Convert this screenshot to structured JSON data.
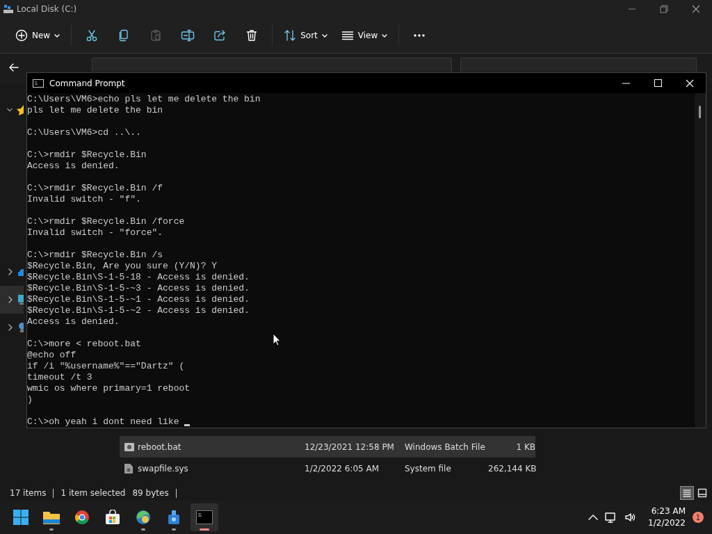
{
  "explorer": {
    "title": "Local Disk (C:)",
    "toolbar": [
      {
        "kind": "new",
        "label": "New",
        "disabled": false
      },
      {
        "kind": "cut",
        "disabled": false
      },
      {
        "kind": "copy",
        "disabled": false
      },
      {
        "kind": "paste",
        "disabled": true
      },
      {
        "kind": "rename",
        "disabled": false
      },
      {
        "kind": "share",
        "disabled": false
      },
      {
        "kind": "delete",
        "disabled": false
      },
      {
        "kind": "sort",
        "label": "Sort",
        "disabled": false
      },
      {
        "kind": "view",
        "label": "View",
        "disabled": false
      },
      {
        "kind": "more",
        "disabled": false
      }
    ],
    "sidebar": {
      "items": [
        {
          "kind": "quick-access",
          "expanded": true,
          "selected": false
        },
        {
          "kind": "cloud",
          "expanded": false,
          "selected": false
        },
        {
          "kind": "computer",
          "expanded": false,
          "selected": true
        },
        {
          "kind": "network",
          "expanded": false,
          "selected": false
        }
      ]
    },
    "files": [
      {
        "name": "reboot.bat",
        "kind": "batch",
        "modified": "12/23/2021 12:58 PM",
        "type": "Windows Batch File",
        "size": "1 KB",
        "selected": true
      },
      {
        "name": "swapfile.sys",
        "kind": "system",
        "modified": "1/2/2022 6:05 AM",
        "type": "System file",
        "size": "262,144 KB",
        "selected": false
      }
    ],
    "status_bar": {
      "items": "17 items",
      "selection": "1 item selected",
      "size": "89 bytes",
      "views": [
        {
          "kind": "details",
          "selected": true
        },
        {
          "kind": "tiles",
          "selected": false
        }
      ]
    }
  },
  "console": {
    "title": "Command Prompt",
    "blocks": [
      [
        "C:\\Users\\VM6>echo pls let me delete the bin",
        "pls let me delete the bin"
      ],
      [
        "C:\\Users\\VM6>cd ..\\.."
      ],
      [
        "C:\\>rmdir $Recycle.Bin",
        "Access is denied."
      ],
      [
        "C:\\>rmdir $Recycle.Bin /f",
        "Invalid switch - \"f\"."
      ],
      [
        "C:\\>rmdir $Recycle.Bin /force",
        "Invalid switch - \"force\"."
      ],
      [
        "C:\\>rmdir $Recycle.Bin /s",
        "$Recycle.Bin, Are you sure (Y/N)? Y",
        "$Recycle.Bin\\S-1-5-18 - Access is denied.",
        "$Recycle.Bin\\S-1-5-~3 - Access is denied.",
        "$Recycle.Bin\\S-1-5-~1 - Access is denied.",
        "$Recycle.Bin\\S-1-5-~2 - Access is denied.",
        "Access is denied."
      ],
      [
        "C:\\>more < reboot.bat",
        "@echo off",
        "if /i \"%username%\"==\"Dartz\" (",
        "timeout /t 3",
        "wmic os where primary=1 reboot",
        ")"
      ],
      [
        "C:\\>oh yeah i dont need like"
      ]
    ]
  },
  "taskbar": {
    "apps": [
      {
        "kind": "start",
        "running": false,
        "selected": false
      },
      {
        "kind": "folder",
        "running": true,
        "selected": false
      },
      {
        "kind": "browser",
        "running": false,
        "selected": false
      },
      {
        "kind": "store",
        "running": false,
        "selected": false
      },
      {
        "kind": "browser-beta",
        "running": true,
        "selected": false
      },
      {
        "kind": "tool",
        "running": true,
        "selected": false
      },
      {
        "kind": "terminal",
        "running": true,
        "selected": true
      }
    ],
    "clock": {
      "time": "6:23 AM",
      "date": "1/2/2022"
    },
    "notifications": "1"
  }
}
